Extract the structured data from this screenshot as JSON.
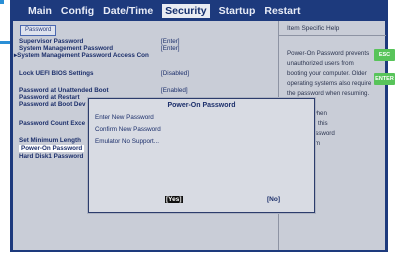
{
  "menu": [
    "Main",
    "Config",
    "Date/Time",
    "Security",
    "Startup",
    "Restart"
  ],
  "active_menu": "Security",
  "tab_chip": "Password",
  "items": [
    "Supervisor Password",
    "System Management Password",
    "System Management Password Access Con",
    "Lock UEFI BIOS Settings",
    "Password at Unattended Boot",
    "Password at Restart",
    "Password at Boot Dev",
    "Password Count Exce",
    "Set Minimum Length",
    "Power-On Password",
    "Hard Disk1 Password"
  ],
  "values": [
    "[Enter]",
    "[Enter]",
    "[Disabled]",
    "[Enabled]"
  ],
  "help": {
    "title": "Item Specific Help",
    "lines": [
      "Power-On Password prevents",
      "unauthorized users from",
      "booting your computer. Older",
      "operating systems also require",
      "the password when resuming.",
      "",
      "...ccount when",
      "...etting for this",
      "...e the Password",
      "... the Alarm"
    ]
  },
  "dialog": {
    "title": "Power-On Password",
    "lines": [
      "Enter New Password",
      "Confirm New Password",
      "Emulator No Support..."
    ],
    "yes": "[Yes]",
    "no": "[No]"
  },
  "keys": [
    "ESC",
    "ENTER"
  ],
  "colors": {
    "frame": "#1d3a7d",
    "screen": "#c9cdd7",
    "key_badge": "#58c45a",
    "accent": "#2a8fd6"
  }
}
